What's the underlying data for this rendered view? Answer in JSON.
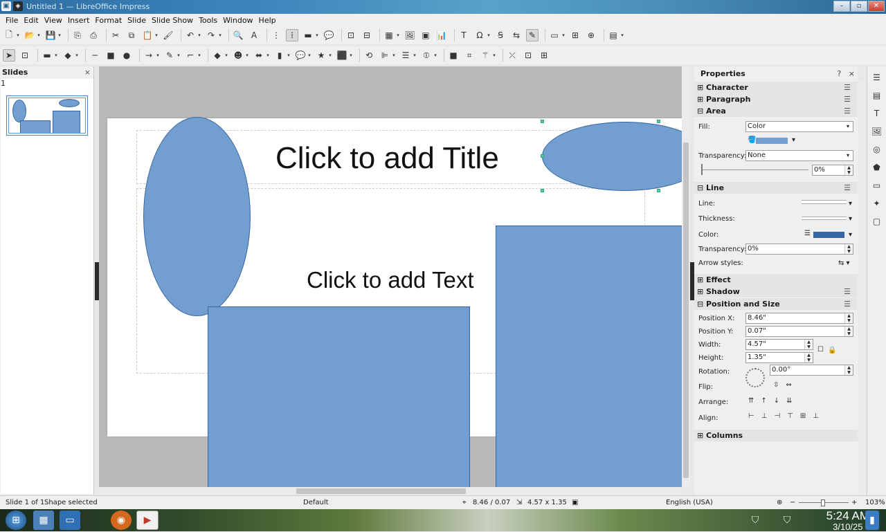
{
  "window": {
    "title": "Untitled 1 — LibreOffice Impress",
    "minimize": "–",
    "maximize": "▫",
    "close": "✕"
  },
  "menu": [
    "File",
    "Edit",
    "View",
    "Insert",
    "Format",
    "Slide",
    "Slide Show",
    "Tools",
    "Window",
    "Help"
  ],
  "slides_panel": {
    "title": "Slides",
    "close": "×",
    "slide_number": "1"
  },
  "slide": {
    "title_placeholder": "Click to add Title",
    "text_placeholder": "Click to add Text"
  },
  "sidebar": {
    "title": "Properties",
    "help": "?",
    "close": "×",
    "menu": "☰",
    "sections": {
      "character": "Character",
      "paragraph": "Paragraph",
      "area": "Area",
      "line": "Line",
      "effect": "Effect",
      "shadow": "Shadow",
      "position_size": "Position and Size",
      "columns": "Columns"
    },
    "area": {
      "fill_label": "Fill:",
      "fill_value": "Color",
      "fill_color": "#729fcf",
      "transparency_label": "Transparency:",
      "transparency_value": "None",
      "transparency_pct": "0%"
    },
    "line": {
      "line_label": "Line:",
      "thickness_label": "Thickness:",
      "color_label": "Color:",
      "line_color": "#3465a4",
      "transparency_label": "Transparency:",
      "transparency_value": "0%",
      "arrow_label": "Arrow styles:"
    },
    "position": {
      "x_label": "Position X:",
      "x_value": "8.46\"",
      "y_label": "Position Y:",
      "y_value": "0.07\"",
      "width_label": "Width:",
      "width_value": "4.57\"",
      "height_label": "Height:",
      "height_value": "1.35\"",
      "rotation_label": "Rotation:",
      "rotation_value": "0.00°",
      "flip_label": "Flip:",
      "arrange_label": "Arrange:",
      "align_label": "Align:"
    }
  },
  "status": {
    "slide": "Slide 1 of 1",
    "selection": "Shape selected",
    "layout": "Default",
    "position": "8.46 / 0.07",
    "size": "4.57 x 1.35",
    "language": "English (USA)",
    "zoom": "103%"
  },
  "taskbar": {
    "time": "5:24 AM",
    "date": "3/10/25"
  }
}
